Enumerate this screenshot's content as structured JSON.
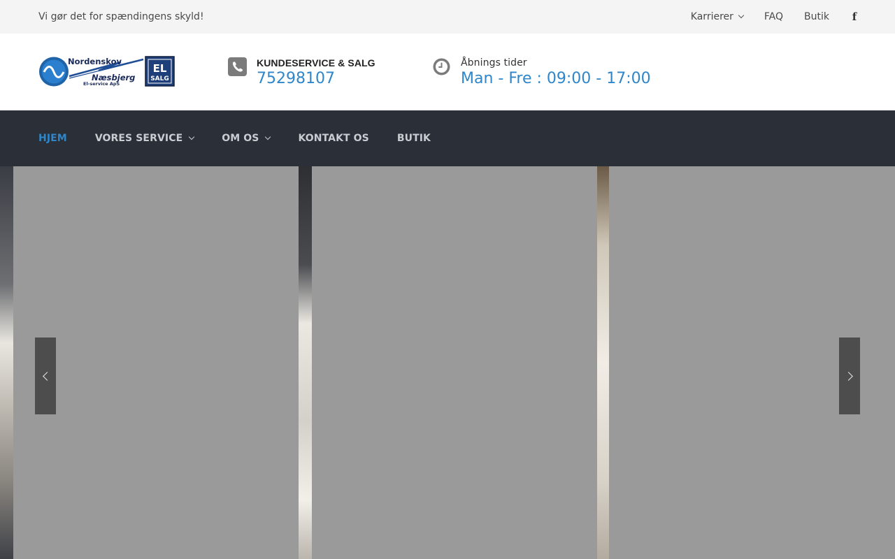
{
  "topbar": {
    "tagline": "Vi gør det for spændingens skyld!",
    "links": [
      {
        "label": "Karrierer",
        "has_dropdown": true
      },
      {
        "label": "FAQ"
      },
      {
        "label": "Butik"
      }
    ],
    "social_icon": "facebook-icon"
  },
  "logo": {
    "line1": "Nordenskov",
    "line2": "Næsbjerg",
    "line3": "El-service ApS",
    "badge_top": "EL",
    "badge_bottom": "SALG"
  },
  "contact": {
    "phone_label": "KUNDESERVICE & SALG",
    "phone_value": "75298107",
    "phone_icon": "phone-icon",
    "hours_label": "Åbnings tider",
    "hours_value": "Man - Fre : 09:00 - 17:00",
    "hours_icon": "clock-icon"
  },
  "nav": {
    "items": [
      {
        "label": "HJEM",
        "active": true
      },
      {
        "label": "VORES SERVICE",
        "has_dropdown": true
      },
      {
        "label": "OM OS",
        "has_dropdown": true
      },
      {
        "label": "KONTAKT OS"
      },
      {
        "label": "BUTIK"
      }
    ]
  },
  "slider": {
    "prev_icon": "chevron-left-icon",
    "next_icon": "chevron-right-icon"
  },
  "colors": {
    "accent": "#2f86c9",
    "nav_bg": "#2a2f38",
    "topbar_bg": "#f4f4f4"
  }
}
